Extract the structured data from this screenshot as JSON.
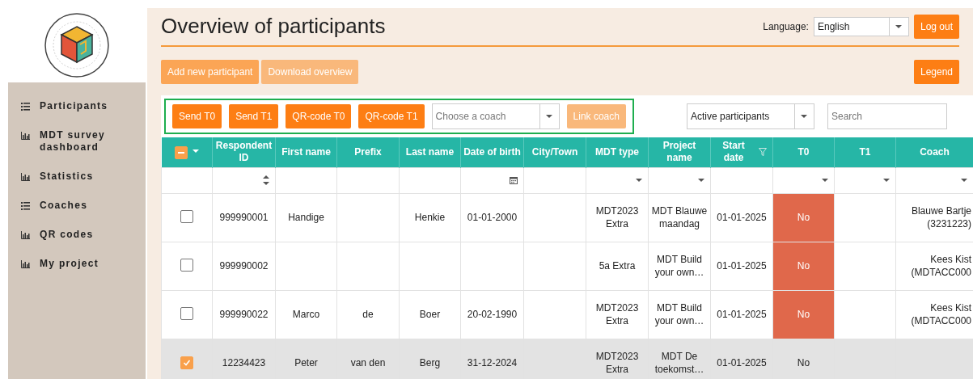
{
  "sidebar": {
    "items": [
      {
        "label": "Participants",
        "kind": "list",
        "selected": false
      },
      {
        "label": "MDT survey dashboard",
        "kind": "chart",
        "selected": false
      },
      {
        "label": "Statistics",
        "kind": "chart",
        "selected": false
      },
      {
        "label": "Coaches",
        "kind": "list",
        "selected": false
      },
      {
        "label": "QR codes",
        "kind": "chart",
        "selected": false
      },
      {
        "label": "My project",
        "kind": "chart",
        "selected": false
      }
    ]
  },
  "header": {
    "title": "Overview of participants",
    "language_label": "Language:",
    "language": "English",
    "logout": "Log out"
  },
  "actions": [
    {
      "label": "Add new participant",
      "disabled": false
    },
    {
      "label": "Download overview",
      "disabled": true
    }
  ],
  "legend": "Legend",
  "toolbar": {
    "buttons": [
      {
        "label": "Send T0",
        "disabled": false
      },
      {
        "label": "Send T1",
        "disabled": false
      },
      {
        "label": "QR-code T0",
        "disabled": false
      },
      {
        "label": "QR-code T1",
        "disabled": false
      }
    ],
    "coach_select": {
      "placeholder": "Choose a coach"
    },
    "link_coach": {
      "label": "Link coach",
      "disabled": true
    },
    "status_filter": "Active participants",
    "search": {
      "placeholder": "Search"
    }
  },
  "table": {
    "select_all": {
      "indeterminate": true
    },
    "columns": [
      {
        "label": "Respondent ID",
        "kind": "sort",
        "filtered": false
      },
      {
        "label": "First name",
        "kind": "text",
        "filtered": false
      },
      {
        "label": "Prefix",
        "kind": "text",
        "filtered": false
      },
      {
        "label": "Last name",
        "kind": "text",
        "filtered": false
      },
      {
        "label": "Date of birth",
        "kind": "date",
        "filtered": false
      },
      {
        "label": "City/Town",
        "kind": "text",
        "filtered": false
      },
      {
        "label": "MDT type",
        "kind": "select",
        "filtered": false
      },
      {
        "label": "Project name",
        "kind": "select",
        "filtered": false
      },
      {
        "label": "Start date",
        "kind": "text",
        "filtered": true
      },
      {
        "label": "T0",
        "kind": "select",
        "filtered": false
      },
      {
        "label": "T1",
        "kind": "select",
        "filtered": false
      },
      {
        "label": "Coach",
        "kind": "select",
        "filtered": false
      }
    ],
    "rows": [
      {
        "selected": false,
        "t0_alert": true,
        "cells": [
          "999990001",
          "Handige",
          "",
          "Henkie",
          "01-01-2000",
          "",
          "MDT2023 Extra",
          "MDT Blauwe maandag",
          "01-01-2025",
          "No",
          "",
          "Blauwe Bartje (3231223)"
        ]
      },
      {
        "selected": false,
        "t0_alert": true,
        "cells": [
          "999990002",
          "",
          "",
          "",
          "",
          "",
          "5a Extra",
          "MDT Build your own…",
          "01-01-2025",
          "No",
          "",
          "Kees Kist (MDTACC000"
        ]
      },
      {
        "selected": false,
        "t0_alert": true,
        "cells": [
          "999990022",
          "Marco",
          "de",
          "Boer",
          "20-02-1990",
          "",
          "MDT2023 Extra",
          "MDT Build your own…",
          "01-01-2025",
          "No",
          "",
          "Kees Kist (MDTACC000"
        ]
      },
      {
        "selected": true,
        "t0_alert": false,
        "cells": [
          "12234423",
          "Peter",
          "van den",
          "Berg",
          "31-12-2024",
          "",
          "MDT2023 Extra",
          "MDT De toekomst…",
          "01-01-2025",
          "No",
          "",
          ""
        ]
      }
    ]
  }
}
